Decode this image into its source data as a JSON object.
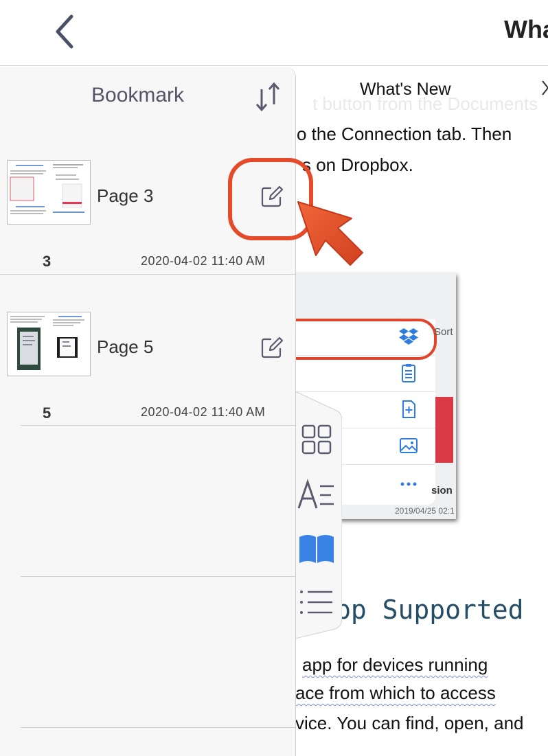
{
  "topbar": {
    "title": "Wha"
  },
  "document": {
    "header_title": "What's New",
    "ghost_text": "t button from the Documents",
    "lines_top": [
      "o the Connection tab. Then",
      "s on Dropbox."
    ],
    "screenshot": {
      "sort_text": "Sort",
      "sion_text": "sion",
      "date_text": "2019/04/25 02:1"
    },
    "heading": "pp Supported",
    "lines_bottom": [
      "app for devices running",
      "ace from which to access",
      "vice. You can find, open, and"
    ]
  },
  "bookmark_panel": {
    "title": "Bookmark",
    "items": [
      {
        "label": "Page 3",
        "number": "3",
        "date": "2020-04-02 11:40 AM"
      },
      {
        "label": "Page 5",
        "number": "5",
        "date": "2020-04-02 11:40 AM"
      }
    ]
  },
  "side_tabs": [
    {
      "icon": "grid-icon",
      "active": false
    },
    {
      "icon": "text-format-icon",
      "active": false
    },
    {
      "icon": "book-icon",
      "active": true
    },
    {
      "icon": "list-icon",
      "active": false
    }
  ],
  "colors": {
    "accent_blue": "#3a83e6",
    "callout_red": "#e54a2a",
    "panel_bg": "#f7f7f8",
    "icon_gray": "#5a5a6e"
  }
}
